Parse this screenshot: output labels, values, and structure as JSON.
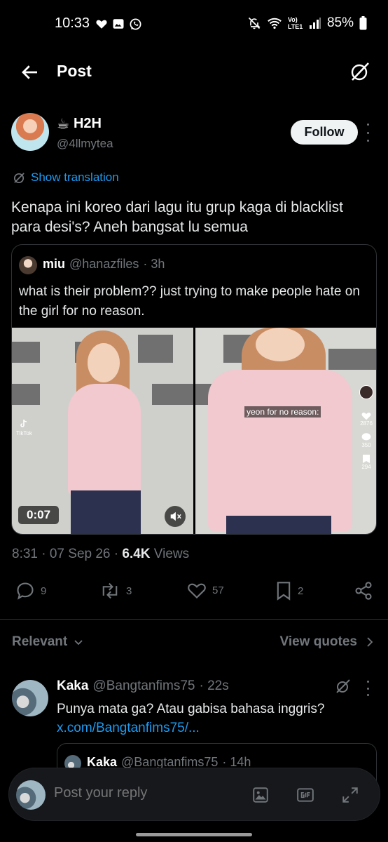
{
  "status_bar": {
    "time": "10:33",
    "battery": "85%",
    "net_label": "Vo) LTE1"
  },
  "header": {
    "title": "Post"
  },
  "author": {
    "emoji": "☕",
    "name": "H2H",
    "handle": "@4llmytea",
    "follow_label": "Follow"
  },
  "translate_label": "Show translation",
  "post": {
    "text": "Kenapa ini koreo dari lagu itu grup kaga di blacklist para desi's? Aneh bangsat lu semua",
    "timestamp": "8:31 · 07 Sep 26 · ",
    "views_count": "6.4K",
    "views_label": " Views"
  },
  "quote": {
    "name": "miu",
    "handle": "@hanazfiles",
    "age": "· 3h",
    "text": "what is their problem?? just trying to make people hate on the girl for no reason.",
    "video_duration": "0:07",
    "overlay_caption": "yeon for no reason:",
    "tiktok_label": "TikTok",
    "side_likes": "2876",
    "side_comments": "350",
    "side_saves": "294"
  },
  "actions": {
    "replies": "9",
    "reposts": "3",
    "likes": "57",
    "bookmarks": "2"
  },
  "filter": {
    "relevant_label": "Relevant",
    "view_quotes_label": "View quotes"
  },
  "reply": {
    "name": "Kaka",
    "handle": "@Bangtanfims75",
    "age": "· 22s",
    "text": "Punya mata ga? Atau gabisa bahasa inggris?",
    "link": "x.com/Bangtanfims75/...",
    "nested_name": "Kaka",
    "nested_handle": "@Bangtanfims75",
    "nested_age": "· 14h"
  },
  "composer": {
    "placeholder": "Post your reply"
  },
  "colors": {
    "accent": "#1d9bf0",
    "muted": "#71767b",
    "background": "#000000"
  }
}
